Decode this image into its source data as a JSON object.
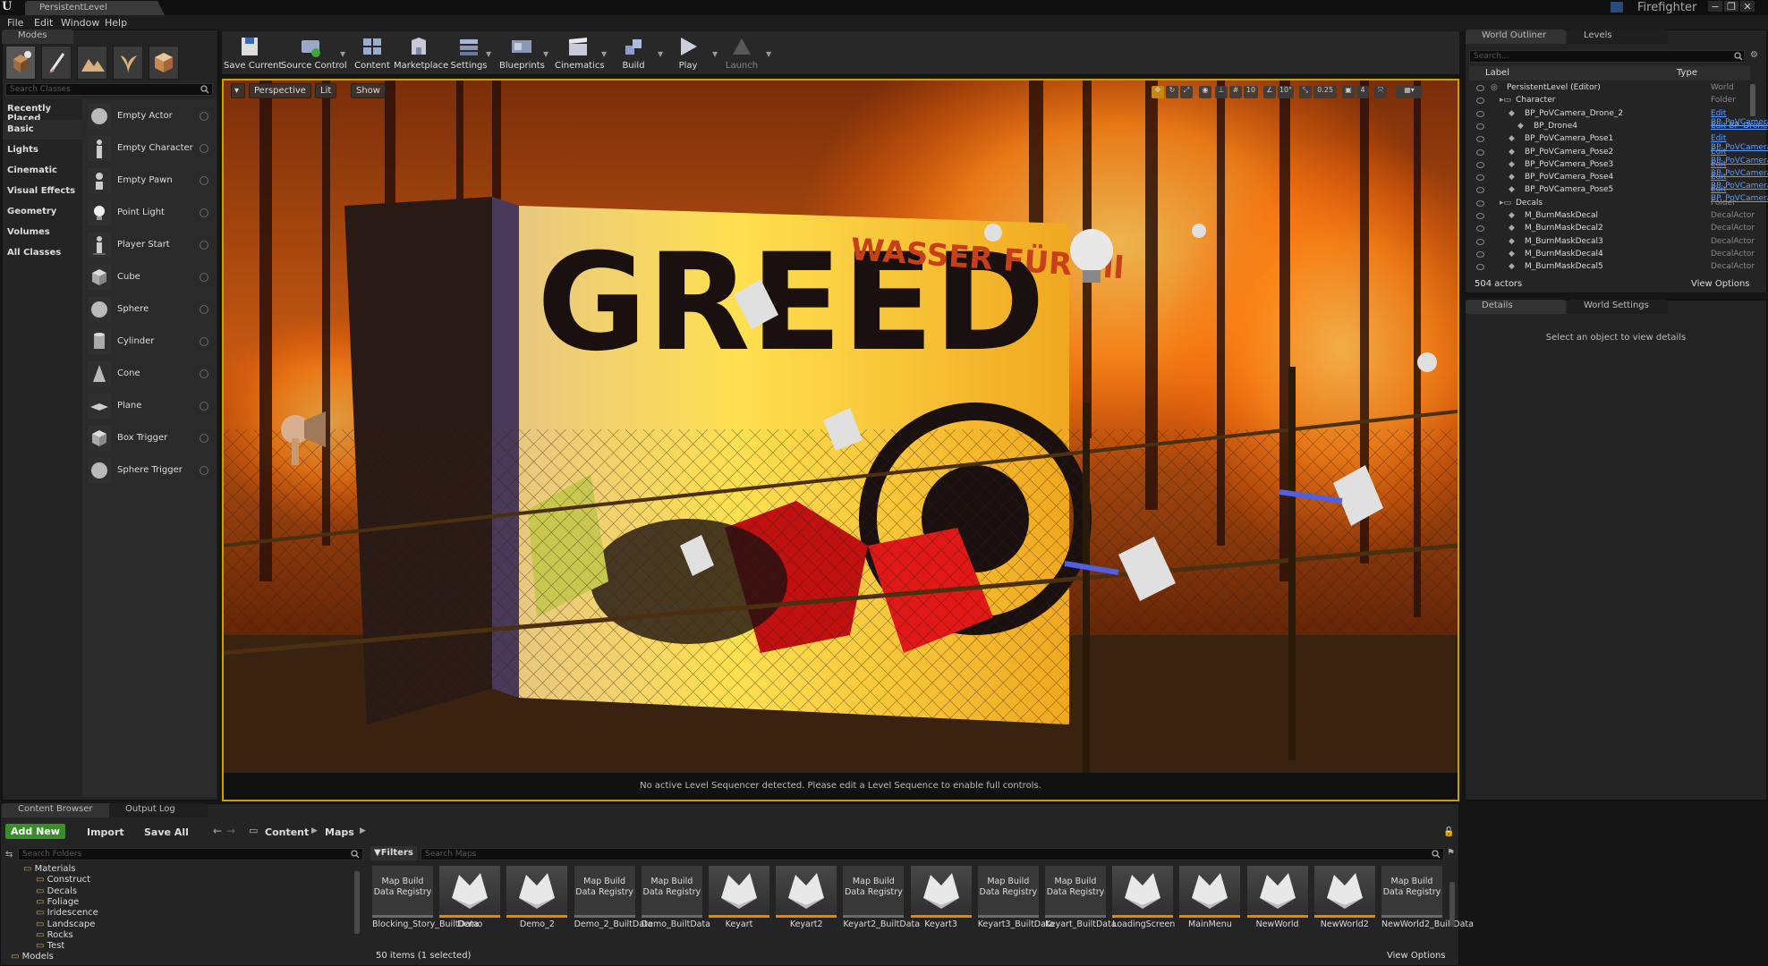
{
  "window": {
    "tab_title": "PersistentLevel",
    "app_name": "Firefighter",
    "controls": [
      "−",
      "❐",
      "✕"
    ]
  },
  "menu": [
    "File",
    "Edit",
    "Window",
    "Help"
  ],
  "modes": {
    "tab_label": "Modes",
    "search_placeholder": "Search Classes",
    "categories": [
      "Recently Placed",
      "Basic",
      "Lights",
      "Cinematic",
      "Visual Effects",
      "Geometry",
      "Volumes",
      "All Classes"
    ],
    "active_category": "Basic",
    "items": [
      "Empty Actor",
      "Empty Character",
      "Empty Pawn",
      "Point Light",
      "Player Start",
      "Cube",
      "Sphere",
      "Cylinder",
      "Cone",
      "Plane",
      "Box Trigger",
      "Sphere Trigger"
    ]
  },
  "toolbar": {
    "buttons": [
      "Save Current",
      "Source Control",
      "Content",
      "Marketplace",
      "Settings",
      "Blueprints",
      "Cinematics",
      "Build",
      "Play",
      "Launch"
    ]
  },
  "viewport": {
    "perspective_label": "Perspective",
    "lit_label": "Lit",
    "show_label": "Show",
    "snap_value": "10",
    "rot_value": "10°",
    "scale_value": "0.25",
    "cam_speed": "4",
    "status_message": "No active Level Sequencer detected. Please edit a Level Sequence to enable full controls.",
    "scene": {
      "sign_text": "GREED",
      "sign_subtext": "WASSER FÜR all"
    }
  },
  "outliner": {
    "tabs": [
      "World Outliner",
      "Levels"
    ],
    "search_placeholder": "Search...",
    "col_label": "Label",
    "col_type": "Type",
    "rows": [
      {
        "label": "PersistentLevel (Editor)",
        "type": "World",
        "link": false
      },
      {
        "label": "Character",
        "type": "Folder",
        "link": false
      },
      {
        "label": "BP_PoVCamera_Drone_2",
        "type": "Edit BP_PoVCamera",
        "link": true
      },
      {
        "label": "BP_Drone4",
        "type": "Edit BP_Drone",
        "link": true
      },
      {
        "label": "BP_PoVCamera_Pose1",
        "type": "Edit BP_PoVCamera",
        "link": true
      },
      {
        "label": "BP_PoVCamera_Pose2",
        "type": "Edit BP_PoVCamera",
        "link": true
      },
      {
        "label": "BP_PoVCamera_Pose3",
        "type": "Edit BP_PoVCamera",
        "link": true
      },
      {
        "label": "BP_PoVCamera_Pose4",
        "type": "Edit BP_PoVCamera",
        "link": true
      },
      {
        "label": "BP_PoVCamera_Pose5",
        "type": "Edit BP_PoVCamera",
        "link": true
      },
      {
        "label": "Decals",
        "type": "Folder",
        "link": false
      },
      {
        "label": "M_BurnMaskDecal",
        "type": "DecalActor",
        "link": false
      },
      {
        "label": "M_BurnMaskDecal2",
        "type": "DecalActor",
        "link": false
      },
      {
        "label": "M_BurnMaskDecal3",
        "type": "DecalActor",
        "link": false
      },
      {
        "label": "M_BurnMaskDecal4",
        "type": "DecalActor",
        "link": false
      },
      {
        "label": "M_BurnMaskDecal5",
        "type": "DecalActor",
        "link": false
      }
    ],
    "actor_count": "504 actors",
    "view_options": "View Options"
  },
  "details": {
    "tabs": [
      "Details",
      "World Settings"
    ],
    "empty_message": "Select an object to view details"
  },
  "content_browser": {
    "tabs": [
      "Content Browser",
      "Output Log"
    ],
    "add_new": "Add New",
    "import": "Import",
    "save_all": "Save All",
    "path": [
      "Content",
      "Maps"
    ],
    "search_folders_placeholder": "Search Folders",
    "filters_label": "Filters",
    "search_assets_placeholder": "Search Maps",
    "folders": [
      "Materials",
      "Construct",
      "Decals",
      "Foliage",
      "Iridescence",
      "Landscape",
      "Rocks",
      "Test",
      "Models"
    ],
    "assets": [
      {
        "name": "Blocking_Story_BuiltData",
        "kind": "data",
        "thumb": "Map Build Data Registry"
      },
      {
        "name": "Demo",
        "kind": "map",
        "thumb": ""
      },
      {
        "name": "Demo_2",
        "kind": "map",
        "thumb": ""
      },
      {
        "name": "Demo_2_BuiltData",
        "kind": "data",
        "thumb": "Map Build Data Registry"
      },
      {
        "name": "Demo_BuiltData",
        "kind": "data",
        "thumb": "Map Build Data Registry"
      },
      {
        "name": "Keyart",
        "kind": "map",
        "thumb": ""
      },
      {
        "name": "Keyart2",
        "kind": "map",
        "thumb": ""
      },
      {
        "name": "Keyart2_BuiltData",
        "kind": "data",
        "thumb": "Map Build Data Registry"
      },
      {
        "name": "Keyart3",
        "kind": "map",
        "thumb": ""
      },
      {
        "name": "Keyart3_BuiltData",
        "kind": "data",
        "thumb": "Map Build Data Registry"
      },
      {
        "name": "Keyart_BuiltData",
        "kind": "data",
        "thumb": "Map Build Data Registry"
      },
      {
        "name": "LoadingScreen",
        "kind": "map",
        "thumb": ""
      },
      {
        "name": "MainMenu",
        "kind": "map",
        "thumb": ""
      },
      {
        "name": "NewWorld",
        "kind": "map",
        "thumb": ""
      },
      {
        "name": "NewWorld2",
        "kind": "map",
        "thumb": ""
      },
      {
        "name": "NewWorld2_BuiltData",
        "kind": "data",
        "thumb": "Map Build Data Registry"
      }
    ],
    "item_count": "50 items (1 selected)",
    "view_options": "View Options"
  },
  "colors": {
    "accent_yellow": "#c8a000",
    "map_bar": "#e08a00",
    "data_bar": "#6a6a6a",
    "link_blue": "#5c9cff",
    "add_green": "#3a8e2a"
  }
}
